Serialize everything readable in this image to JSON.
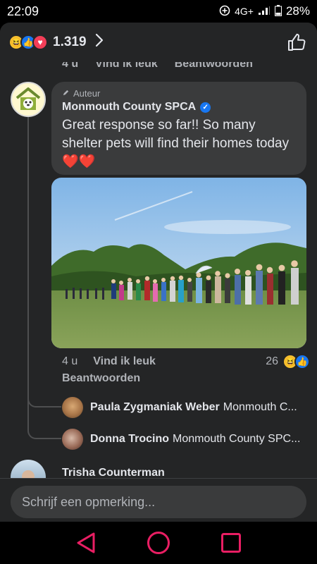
{
  "status": {
    "time": "22:09",
    "network": "4G+",
    "battery": "28%"
  },
  "header": {
    "reaction_count": "1.319",
    "reactions": [
      "haha-icon",
      "like-icon",
      "love-icon"
    ]
  },
  "previous_comment_actions": {
    "time": "4 u",
    "like": "Vind ik leuk",
    "reply": "Beantwoorden"
  },
  "comment": {
    "badge": "Auteur",
    "author": "Monmouth County SPCA",
    "text": "Great response so far!! So many shelter pets will find their homes today",
    "emoji": "❤️❤️",
    "time": "4 u",
    "like": "Vind ik leuk",
    "reply": "Beantwoorden",
    "reaction_count": "26"
  },
  "replies": [
    {
      "name": "Paula Zygmaniak Weber",
      "snippet": "Monmouth C..."
    },
    {
      "name": "Donna Trocino",
      "snippet": "Monmouth County SPC..."
    }
  ],
  "next_comment": {
    "author": "Trisha Counterman"
  },
  "composer": {
    "placeholder": "Schrijf een opmerking..."
  },
  "colors": {
    "background": "#242526",
    "bubble": "#3a3b3c",
    "accent": "#1877f2",
    "nav": "#e91e63"
  }
}
